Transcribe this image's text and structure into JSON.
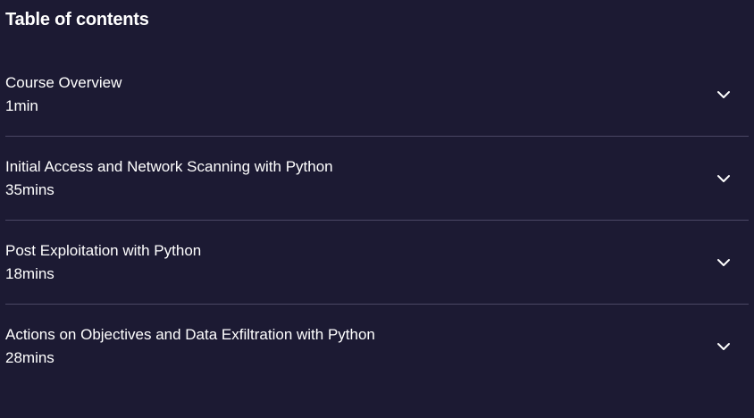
{
  "toc": {
    "title": "Table of contents",
    "items": [
      {
        "title": "Course Overview",
        "duration": "1min",
        "icon": "chevron-down-icon"
      },
      {
        "title": "Initial Access and Network Scanning with Python",
        "duration": "35mins",
        "icon": "chevron-down-icon"
      },
      {
        "title": "Post Exploitation with Python",
        "duration": "18mins",
        "icon": "chevron-down-icon"
      },
      {
        "title": "Actions on Objectives and Data Exfiltration with Python",
        "duration": "28mins",
        "icon": "chevron-down-icon"
      }
    ]
  },
  "colors": {
    "background": "#1c1a33",
    "text": "#ffffff",
    "divider": "#4a4764"
  }
}
